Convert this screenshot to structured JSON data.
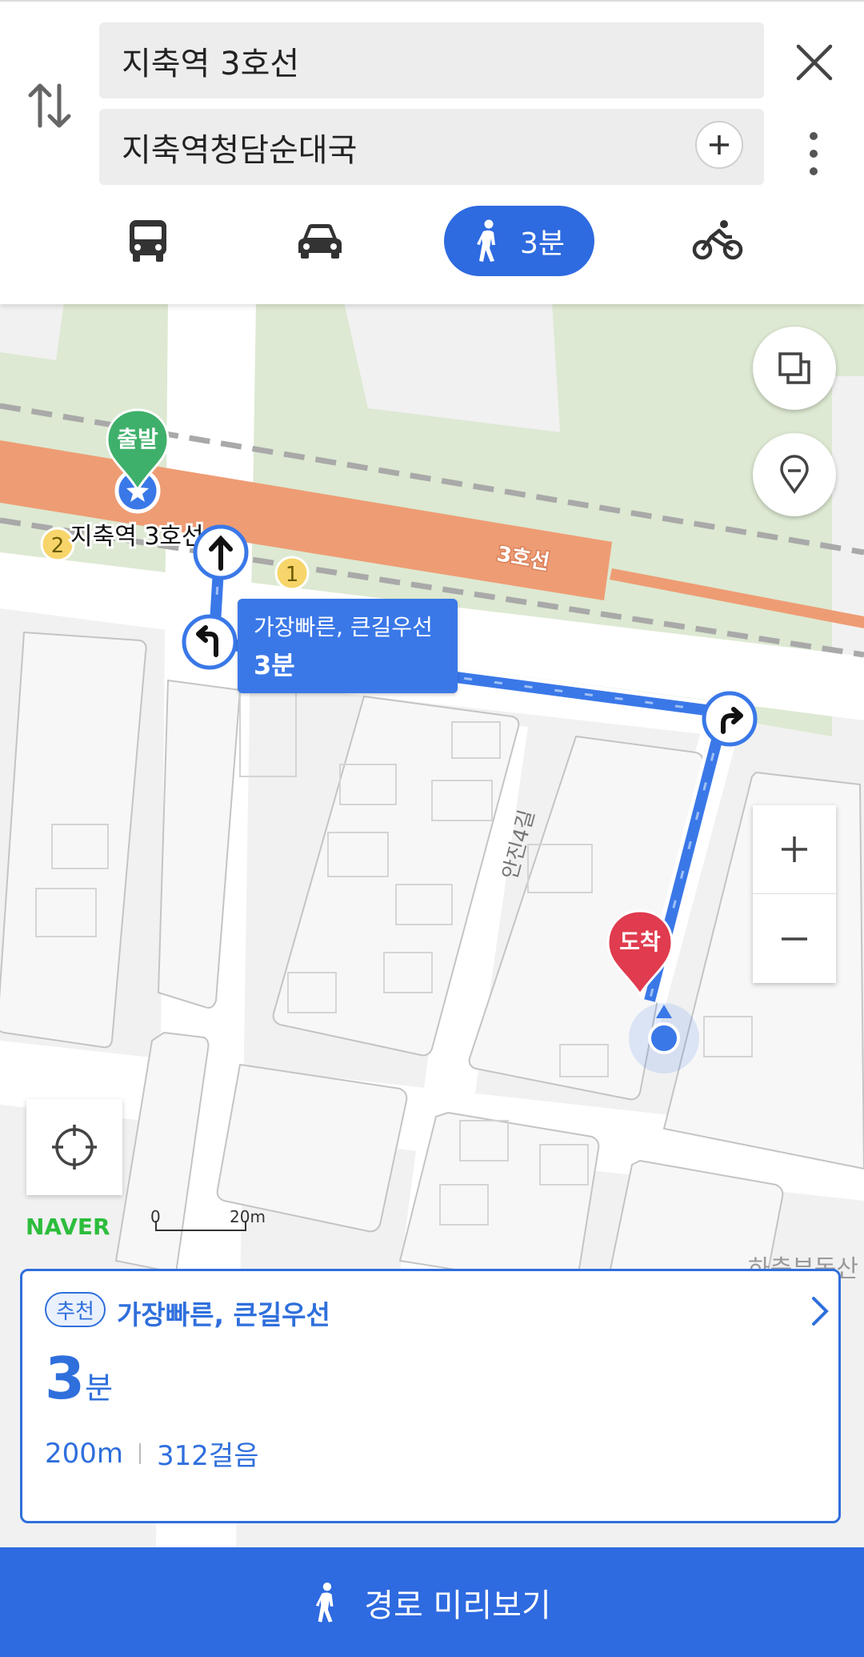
{
  "search": {
    "origin": "지축역 3호선",
    "destination": "지축역청담순대국"
  },
  "modes": {
    "walk_time": "3분"
  },
  "map": {
    "start_marker": "출발",
    "end_marker": "도착",
    "station_label": "지축역 3호선",
    "line_label": "3호선",
    "exit_1": "1",
    "exit_2": "2",
    "route_bubble_title": "가장빠른, 큰길우선",
    "route_bubble_time": "3분",
    "street_label": "안진4길",
    "scale_zero": "0",
    "scale_value": "20m",
    "brand": "NAVER",
    "edge_text": "하충부동산"
  },
  "route_card": {
    "badge": "추천",
    "title": "가장빠른, 큰길우선",
    "time_number": "3",
    "time_unit": "분",
    "distance": "200m",
    "steps": "312걸음"
  },
  "bottom_button": {
    "label": "경로 미리보기"
  },
  "colors": {
    "accent": "#2e6ae0",
    "route": "#3a78e8",
    "start_green": "#3fb06b",
    "end_red": "#e03b4e",
    "subway_line": "#ee9c74"
  }
}
